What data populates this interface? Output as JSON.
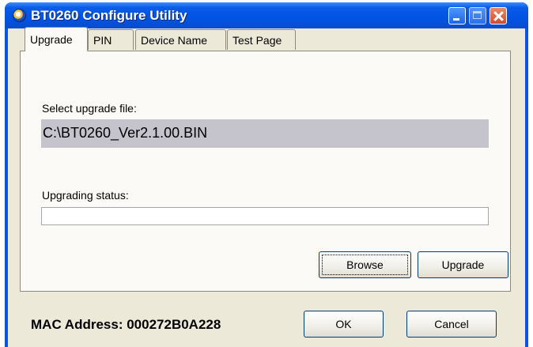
{
  "window": {
    "title": "BT0260 Configure Utility"
  },
  "tabs": [
    {
      "label": "Upgrade",
      "active": true
    },
    {
      "label": "PIN",
      "active": false
    },
    {
      "label": "Device Name",
      "active": false
    },
    {
      "label": "Test Page",
      "active": false
    }
  ],
  "upgrade": {
    "select_label": "Select upgrade file:",
    "file_path": "C:\\BT0260_Ver2.1.00.BIN",
    "status_label": "Upgrading status:",
    "progress": 0,
    "browse_label": "Browse",
    "upgrade_label": "Upgrade"
  },
  "footer": {
    "mac_address": "MAC Address: 000272B0A228",
    "ok_label": "OK",
    "cancel_label": "Cancel"
  },
  "colors": {
    "titlebar": "#0054e3",
    "face": "#ece9d8",
    "panel": "#fbfaf6",
    "field": "#c5c3cc"
  }
}
